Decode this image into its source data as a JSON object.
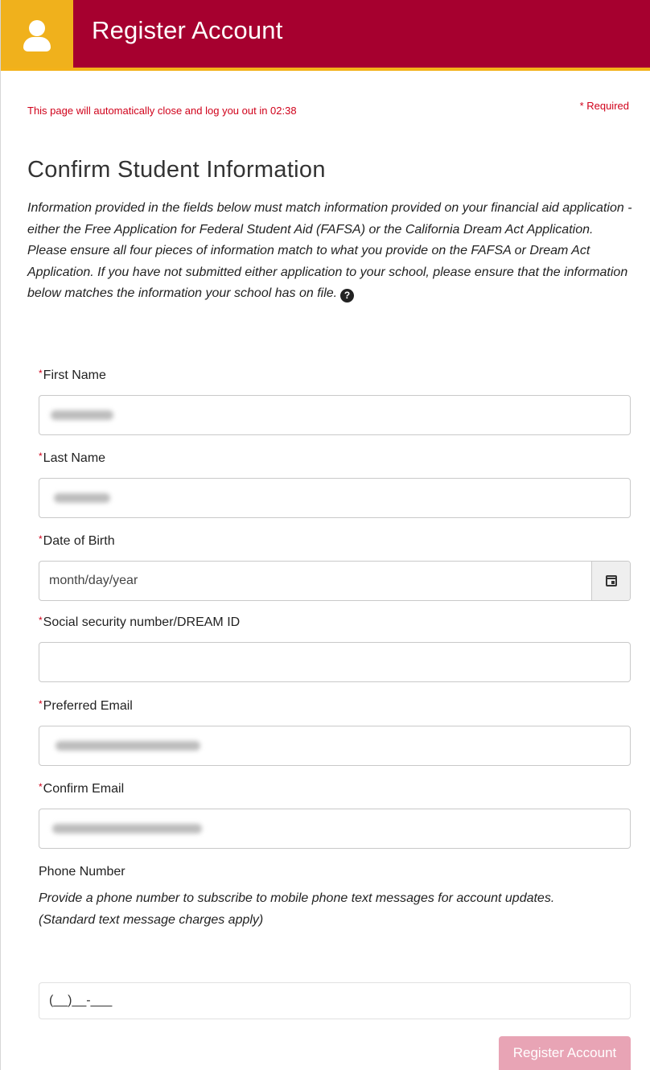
{
  "header": {
    "title": "Register Account",
    "icon": "user-icon"
  },
  "session": {
    "timeout_message": "This page will automatically close and log you out in 02:38"
  },
  "required_note": "* Required",
  "section": {
    "title": "Confirm Student Information",
    "intro": "Information provided in the fields below must match information provided on your financial aid application - either the Free Application for Federal Student Aid (FAFSA) or the California Dream Act Application. Please ensure all four pieces of information match to what you provide on the FAFSA or Dream Act Application. If you have not submitted either application to your school, please ensure that the information below matches the information your school has on file.",
    "help_icon": "question-circle-icon"
  },
  "fields": {
    "first_name": {
      "label": "First Name",
      "required": true,
      "value_redacted": true
    },
    "last_name": {
      "label": "Last Name",
      "required": true,
      "value_redacted": true
    },
    "dob": {
      "label": "Date of Birth",
      "required": true,
      "placeholder": "month/day/year",
      "icon": "calendar-icon"
    },
    "ssn": {
      "label": "Social security number/DREAM ID",
      "required": true,
      "value": ""
    },
    "email": {
      "label": "Preferred Email",
      "required": true,
      "value_redacted": true
    },
    "confirm_email": {
      "label": "Confirm Email",
      "required": true,
      "value_redacted": true
    }
  },
  "phone": {
    "label": "Phone Number",
    "help_line1": "Provide a phone number to subscribe to mobile phone text messages for account updates.",
    "help_line2": "(Standard text message charges apply)",
    "mask": "(__)__-___"
  },
  "submit": {
    "label": "Register Account",
    "disabled": true
  },
  "colors": {
    "brand": "#a6002f",
    "accent": "#f0b11c",
    "required": "#d0021b",
    "button_disabled": "#e8a4b5"
  }
}
